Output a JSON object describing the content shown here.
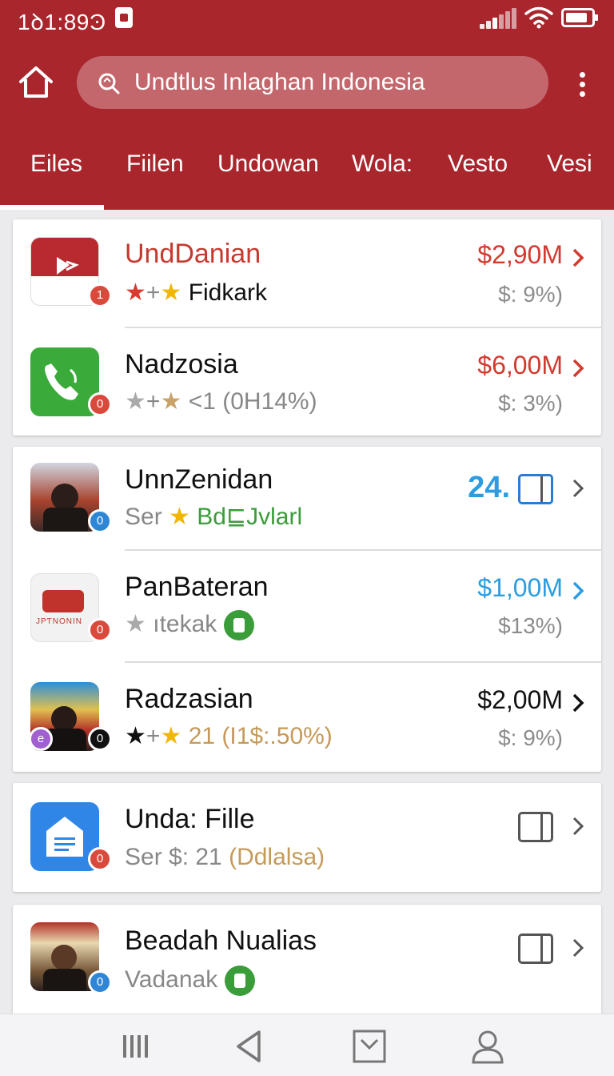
{
  "status": {
    "time": "1ꝺ1:89Ͽ"
  },
  "colors": {
    "brand_red": "#a9262d",
    "price_red": "#d23a2e",
    "price_blue": "#2b9de0",
    "green": "#3a9d3a"
  },
  "header": {
    "search_text": "Undtlus Inlaghan Indonesia",
    "home_icon": "home-icon",
    "more_icon": "more-vertical-icon"
  },
  "tabs": [
    {
      "label": "Eiles",
      "selected": true
    },
    {
      "label": "Fiilen"
    },
    {
      "label": "Undowan"
    },
    {
      "label": "Wola:"
    },
    {
      "label": "Vesto"
    },
    {
      "label": "Vesi"
    }
  ],
  "items": [
    {
      "name": "UndDanian",
      "rating_prefix": "★+",
      "rating_text": "Fidkark",
      "price": "$2,90M",
      "pct": "$: 9%)",
      "badge": "1"
    },
    {
      "name": "Nadzosia",
      "rating_prefix": "★+",
      "rating_text": "<1 (0H14%)",
      "price": "$6,00M",
      "pct": "$: 3%)",
      "badge": "0"
    },
    {
      "name": "UnnZenidan",
      "rating_prefix": "Ser",
      "rating_text": "Bd⊑Jvlarl",
      "price": "24.",
      "badge": "0"
    },
    {
      "name": "PanBateran",
      "rating_prefix": "★",
      "rating_text": "ıtekak",
      "price": "$1,00M",
      "pct": "$13%)",
      "icon_text": "JPƬNONIN",
      "badge": "0"
    },
    {
      "name": "Radzasian",
      "rating_prefix": "★+",
      "rating_text": "21 (I1$:.50%)",
      "price": "$2,00M",
      "pct": "$: 9%)",
      "badge": "0"
    },
    {
      "name": "Unda: Fille",
      "rating_prefix": "Ser $: 21",
      "rating_text": "(Ddlalsa)",
      "badge": "0"
    },
    {
      "name": "Beadah Nualias",
      "rating_text": "Vadanak",
      "badge": "0"
    }
  ],
  "bottom_nav": [
    "recents-icon",
    "back-icon",
    "home-tray-icon",
    "profile-icon"
  ]
}
